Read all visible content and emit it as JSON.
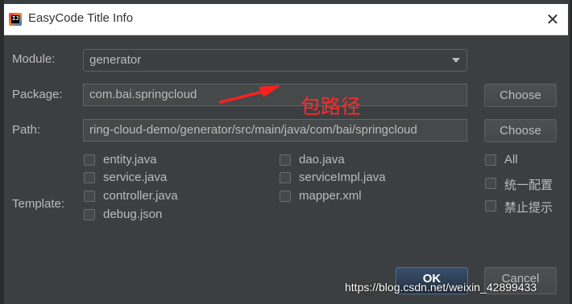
{
  "window": {
    "title": "EasyCode Title Info",
    "close_glyph": "✕"
  },
  "app_icon": {
    "text": "IJ",
    "name": "intellij-icon"
  },
  "form": {
    "module": {
      "label": "Module:",
      "value": "generator"
    },
    "package": {
      "label": "Package:",
      "value": "com.bai.springcloud",
      "button": "Choose"
    },
    "path": {
      "label": "Path:",
      "value": "ring-cloud-demo/generator/src/main/java/com/bai/springcloud",
      "button": "Choose"
    },
    "template_label": "Template:"
  },
  "templates": {
    "col1": [
      "entity.java",
      "service.java",
      "controller.java",
      "debug.json"
    ],
    "col2": [
      "dao.java",
      "serviceImpl.java",
      "mapper.xml"
    ]
  },
  "options": [
    "All",
    "统一配置",
    "禁止提示"
  ],
  "buttons": {
    "ok": "OK",
    "cancel": "Cancel"
  },
  "annotation": {
    "text": "包路径",
    "color": "#ff2a2a"
  },
  "watermark": "https://blog.csdn.net/weixin_42899433"
}
